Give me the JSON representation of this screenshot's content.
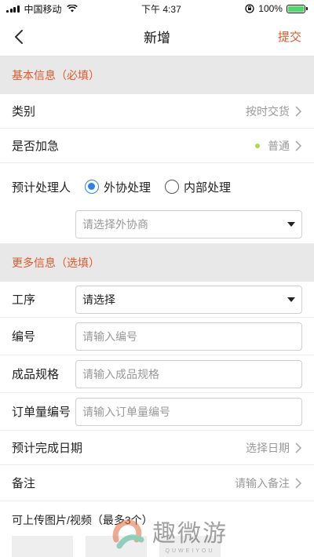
{
  "status_bar": {
    "carrier": "中国移动",
    "time": "下午 4:37",
    "battery": "100%",
    "battery_level": 1.0
  },
  "nav": {
    "title": "新增",
    "submit_label": "提交"
  },
  "sections": {
    "basic_header": "基本信息（必填）",
    "more_header": "更多信息（选填）"
  },
  "basic": {
    "category_label": "类别",
    "category_value": "按时交货",
    "urgent_label": "是否加急",
    "urgent_value": "普通",
    "handler_label": "预计处理人",
    "handler_options": [
      "外协处理",
      "内部处理"
    ],
    "handler_selected": "外协处理",
    "vendor_placeholder": "请选择外协商"
  },
  "more": {
    "process_label": "工序",
    "process_value": "请选择",
    "number_label": "编号",
    "number_placeholder": "请输入编号",
    "spec_label": "成品规格",
    "spec_placeholder": "请输入成品规格",
    "order_label": "订单量编号",
    "order_placeholder": "请输入订单量编号",
    "date_label": "预计完成日期",
    "date_value": "选择日期",
    "remark_label": "备注",
    "remark_value": "请输入备注",
    "upload_label": "可上传图片/视频（最多3个）"
  },
  "watermark": {
    "text": "趣微游",
    "sub": "QUWEIYOU"
  },
  "colors": {
    "accent": "#e05a2b",
    "radio_on": "#2f80e8",
    "urgent_dot": "#b4d84b",
    "section_bg": "#e8e8e8"
  },
  "icons": [
    "wifi-icon",
    "lock-rotation-icon",
    "battery-icon",
    "back-icon",
    "chevron-right-icon",
    "dropdown-icon",
    "camera-icon"
  ]
}
